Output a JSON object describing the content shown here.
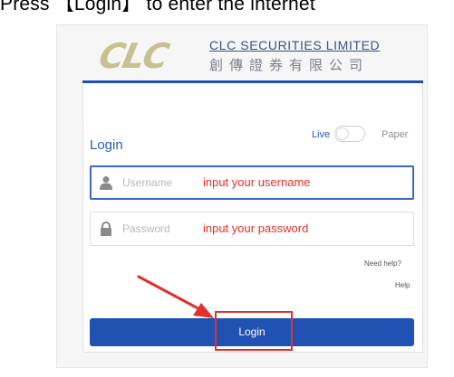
{
  "caption": "Press 【Login】 to enter the internet",
  "logo": {
    "mark": "CLC",
    "company_en": "CLC SECURITIES LIMITED",
    "company_zh": "創傳證券有限公司"
  },
  "mode": {
    "live_label": "Live",
    "paper_label": "Paper",
    "selected": "Live"
  },
  "form": {
    "title": "Login",
    "username": {
      "placeholder": "Username",
      "annotation": "input your username",
      "icon": "user-icon"
    },
    "password": {
      "placeholder": "Password",
      "annotation": "input your password",
      "icon": "lock-icon"
    },
    "need_help": "Need help?",
    "help": "Help",
    "login_button": "Login"
  },
  "colors": {
    "primary": "#1f52b3",
    "annotation": "#e0312b",
    "logo_gold": "#c7c091"
  }
}
